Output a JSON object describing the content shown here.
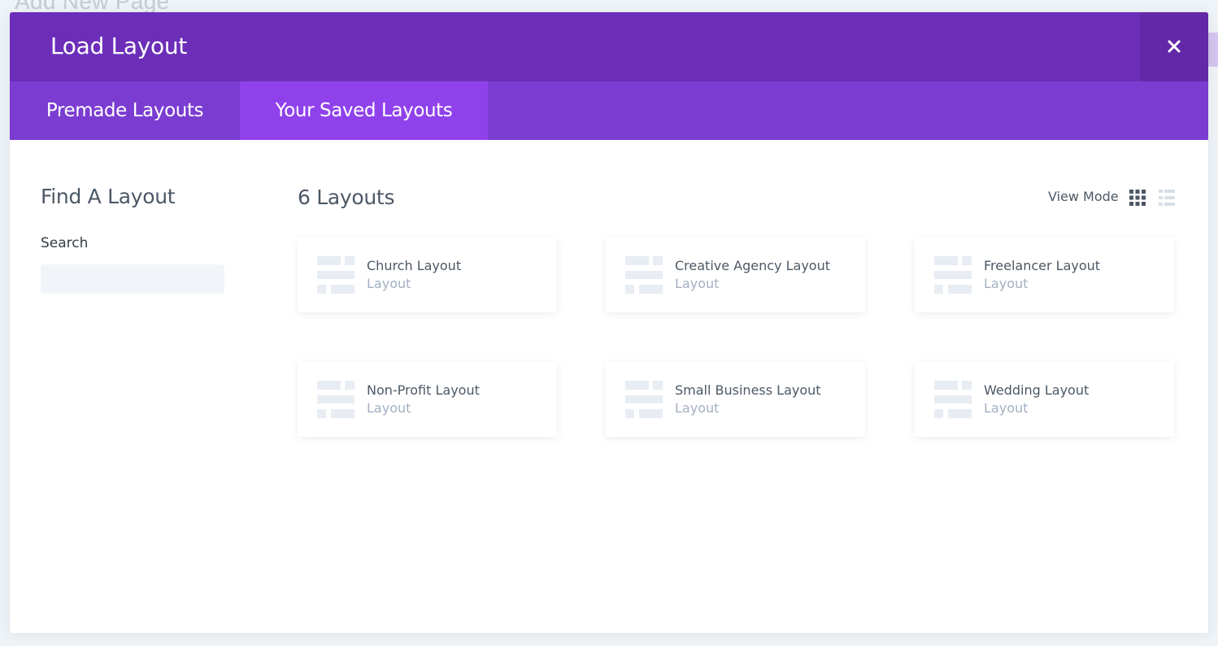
{
  "background": {
    "page_title": "Add New Page"
  },
  "modal": {
    "title": "Load Layout",
    "close_icon": "close-icon",
    "colors": {
      "header": "#6c2eb9",
      "close_area": "#6328a8",
      "tab_bar": "#7b3cd1",
      "active_tab": "#8f42ec"
    }
  },
  "tabs": [
    {
      "label": "Premade Layouts",
      "active": false
    },
    {
      "label": "Your Saved Layouts",
      "active": true
    }
  ],
  "sidebar": {
    "title": "Find A Layout",
    "search_label": "Search",
    "search_value": "",
    "search_placeholder": ""
  },
  "main": {
    "count_title": "6 Layouts",
    "view_mode_label": "View Mode",
    "view_mode_icons": [
      "grid-view-icon",
      "list-view-icon"
    ],
    "active_view_mode": "grid"
  },
  "layouts": [
    {
      "name": "Church Layout",
      "type": "Layout"
    },
    {
      "name": "Creative Agency Layout",
      "type": "Layout"
    },
    {
      "name": "Freelancer Layout",
      "type": "Layout"
    },
    {
      "name": "Non-Profit Layout",
      "type": "Layout"
    },
    {
      "name": "Small Business Layout",
      "type": "Layout"
    },
    {
      "name": "Wedding Layout",
      "type": "Layout"
    }
  ]
}
